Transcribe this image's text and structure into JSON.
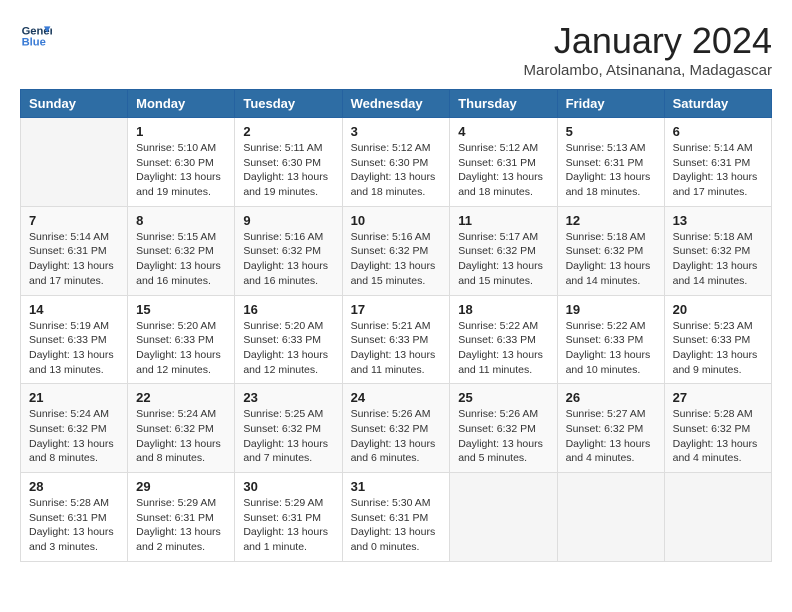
{
  "logo": {
    "line1": "General",
    "line2": "Blue"
  },
  "title": "January 2024",
  "subtitle": "Marolambo, Atsinanana, Madagascar",
  "weekdays": [
    "Sunday",
    "Monday",
    "Tuesday",
    "Wednesday",
    "Thursday",
    "Friday",
    "Saturday"
  ],
  "weeks": [
    [
      {
        "day": "",
        "info": ""
      },
      {
        "day": "1",
        "info": "Sunrise: 5:10 AM\nSunset: 6:30 PM\nDaylight: 13 hours\nand 19 minutes."
      },
      {
        "day": "2",
        "info": "Sunrise: 5:11 AM\nSunset: 6:30 PM\nDaylight: 13 hours\nand 19 minutes."
      },
      {
        "day": "3",
        "info": "Sunrise: 5:12 AM\nSunset: 6:30 PM\nDaylight: 13 hours\nand 18 minutes."
      },
      {
        "day": "4",
        "info": "Sunrise: 5:12 AM\nSunset: 6:31 PM\nDaylight: 13 hours\nand 18 minutes."
      },
      {
        "day": "5",
        "info": "Sunrise: 5:13 AM\nSunset: 6:31 PM\nDaylight: 13 hours\nand 18 minutes."
      },
      {
        "day": "6",
        "info": "Sunrise: 5:14 AM\nSunset: 6:31 PM\nDaylight: 13 hours\nand 17 minutes."
      }
    ],
    [
      {
        "day": "7",
        "info": "Sunrise: 5:14 AM\nSunset: 6:31 PM\nDaylight: 13 hours\nand 17 minutes."
      },
      {
        "day": "8",
        "info": "Sunrise: 5:15 AM\nSunset: 6:32 PM\nDaylight: 13 hours\nand 16 minutes."
      },
      {
        "day": "9",
        "info": "Sunrise: 5:16 AM\nSunset: 6:32 PM\nDaylight: 13 hours\nand 16 minutes."
      },
      {
        "day": "10",
        "info": "Sunrise: 5:16 AM\nSunset: 6:32 PM\nDaylight: 13 hours\nand 15 minutes."
      },
      {
        "day": "11",
        "info": "Sunrise: 5:17 AM\nSunset: 6:32 PM\nDaylight: 13 hours\nand 15 minutes."
      },
      {
        "day": "12",
        "info": "Sunrise: 5:18 AM\nSunset: 6:32 PM\nDaylight: 13 hours\nand 14 minutes."
      },
      {
        "day": "13",
        "info": "Sunrise: 5:18 AM\nSunset: 6:32 PM\nDaylight: 13 hours\nand 14 minutes."
      }
    ],
    [
      {
        "day": "14",
        "info": "Sunrise: 5:19 AM\nSunset: 6:33 PM\nDaylight: 13 hours\nand 13 minutes."
      },
      {
        "day": "15",
        "info": "Sunrise: 5:20 AM\nSunset: 6:33 PM\nDaylight: 13 hours\nand 12 minutes."
      },
      {
        "day": "16",
        "info": "Sunrise: 5:20 AM\nSunset: 6:33 PM\nDaylight: 13 hours\nand 12 minutes."
      },
      {
        "day": "17",
        "info": "Sunrise: 5:21 AM\nSunset: 6:33 PM\nDaylight: 13 hours\nand 11 minutes."
      },
      {
        "day": "18",
        "info": "Sunrise: 5:22 AM\nSunset: 6:33 PM\nDaylight: 13 hours\nand 11 minutes."
      },
      {
        "day": "19",
        "info": "Sunrise: 5:22 AM\nSunset: 6:33 PM\nDaylight: 13 hours\nand 10 minutes."
      },
      {
        "day": "20",
        "info": "Sunrise: 5:23 AM\nSunset: 6:33 PM\nDaylight: 13 hours\nand 9 minutes."
      }
    ],
    [
      {
        "day": "21",
        "info": "Sunrise: 5:24 AM\nSunset: 6:32 PM\nDaylight: 13 hours\nand 8 minutes."
      },
      {
        "day": "22",
        "info": "Sunrise: 5:24 AM\nSunset: 6:32 PM\nDaylight: 13 hours\nand 8 minutes."
      },
      {
        "day": "23",
        "info": "Sunrise: 5:25 AM\nSunset: 6:32 PM\nDaylight: 13 hours\nand 7 minutes."
      },
      {
        "day": "24",
        "info": "Sunrise: 5:26 AM\nSunset: 6:32 PM\nDaylight: 13 hours\nand 6 minutes."
      },
      {
        "day": "25",
        "info": "Sunrise: 5:26 AM\nSunset: 6:32 PM\nDaylight: 13 hours\nand 5 minutes."
      },
      {
        "day": "26",
        "info": "Sunrise: 5:27 AM\nSunset: 6:32 PM\nDaylight: 13 hours\nand 4 minutes."
      },
      {
        "day": "27",
        "info": "Sunrise: 5:28 AM\nSunset: 6:32 PM\nDaylight: 13 hours\nand 4 minutes."
      }
    ],
    [
      {
        "day": "28",
        "info": "Sunrise: 5:28 AM\nSunset: 6:31 PM\nDaylight: 13 hours\nand 3 minutes."
      },
      {
        "day": "29",
        "info": "Sunrise: 5:29 AM\nSunset: 6:31 PM\nDaylight: 13 hours\nand 2 minutes."
      },
      {
        "day": "30",
        "info": "Sunrise: 5:29 AM\nSunset: 6:31 PM\nDaylight: 13 hours\nand 1 minute."
      },
      {
        "day": "31",
        "info": "Sunrise: 5:30 AM\nSunset: 6:31 PM\nDaylight: 13 hours\nand 0 minutes."
      },
      {
        "day": "",
        "info": ""
      },
      {
        "day": "",
        "info": ""
      },
      {
        "day": "",
        "info": ""
      }
    ]
  ]
}
